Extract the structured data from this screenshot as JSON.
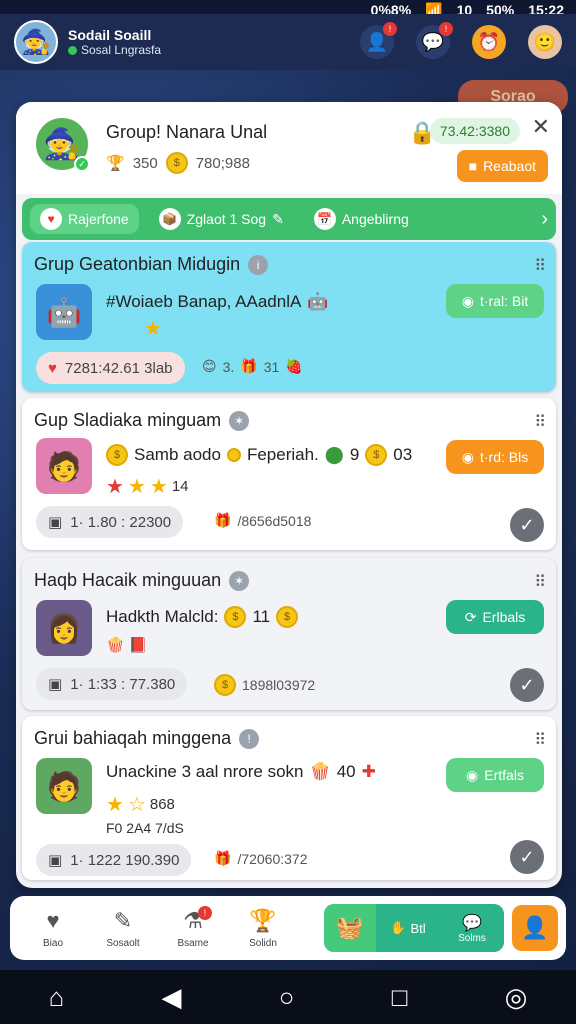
{
  "status_bar": {
    "battery": "50%",
    "network": "10",
    "time": "15:22",
    "left": "0%8%"
  },
  "header": {
    "user_name": "Sodail Soaill",
    "user_status": "Sosal Lngrasfa",
    "icons": [
      "person-add-icon",
      "chat-icon",
      "clock-icon",
      "avatar-icon"
    ],
    "promo": "Sorao"
  },
  "group_card": {
    "title": "Group! Nanara Unal",
    "stat1": "350",
    "stat2": "780;988",
    "balance": "73.42:3380",
    "report_label": "Reabaot"
  },
  "tabs": [
    {
      "label": "Rajerfone",
      "icon": "heart-icon"
    },
    {
      "label": "Zglaot 1 Sog",
      "icon": "chest-icon"
    },
    {
      "label": "Angeblirng",
      "icon": "calendar-icon"
    }
  ],
  "groups": [
    {
      "title": "Grup Geatonbian Midugin",
      "line1": "#Woiaeb Banap, AAadnlA",
      "stat": "7281:42.61 3lab",
      "counts": [
        "3.",
        "31"
      ],
      "action": "t·ral: Bit"
    },
    {
      "title": "Gup Sladiaka minguam",
      "line1": "Samb aodo",
      "line1b": "Feperiah.",
      "line1c": "9",
      "line1d": "03",
      "stars": "14",
      "stat": "1· 1.80 : 22300",
      "gift": "/8656d5018",
      "action": "t·rd: Bls"
    },
    {
      "title": "Haqb Hacaik minguuan",
      "line1": "Hadkth Malcld:",
      "line1b": "11",
      "stat": "1· 1:33 : 77.380",
      "gift": "1898l03972",
      "action": "Erlbals"
    },
    {
      "title": "Grui bahiaqah minggena",
      "line1": "Unackine 3 aal nrore sokn",
      "line1b": "40",
      "stars": "868",
      "sub": "F0 2A4 7/dS",
      "stat": "1· 1222 190.390",
      "gift": "/72060:372",
      "action": "Ertfals"
    }
  ],
  "bottom_nav": {
    "items": [
      {
        "label": "Biao",
        "icon": "heart-icon"
      },
      {
        "label": "Sosaolt",
        "icon": "edit-icon"
      },
      {
        "label": "Bsame",
        "icon": "flask-icon"
      },
      {
        "label": "Solidn",
        "icon": "trophy-icon"
      }
    ],
    "green_label1": "Btl",
    "green_label2": "Solms"
  }
}
